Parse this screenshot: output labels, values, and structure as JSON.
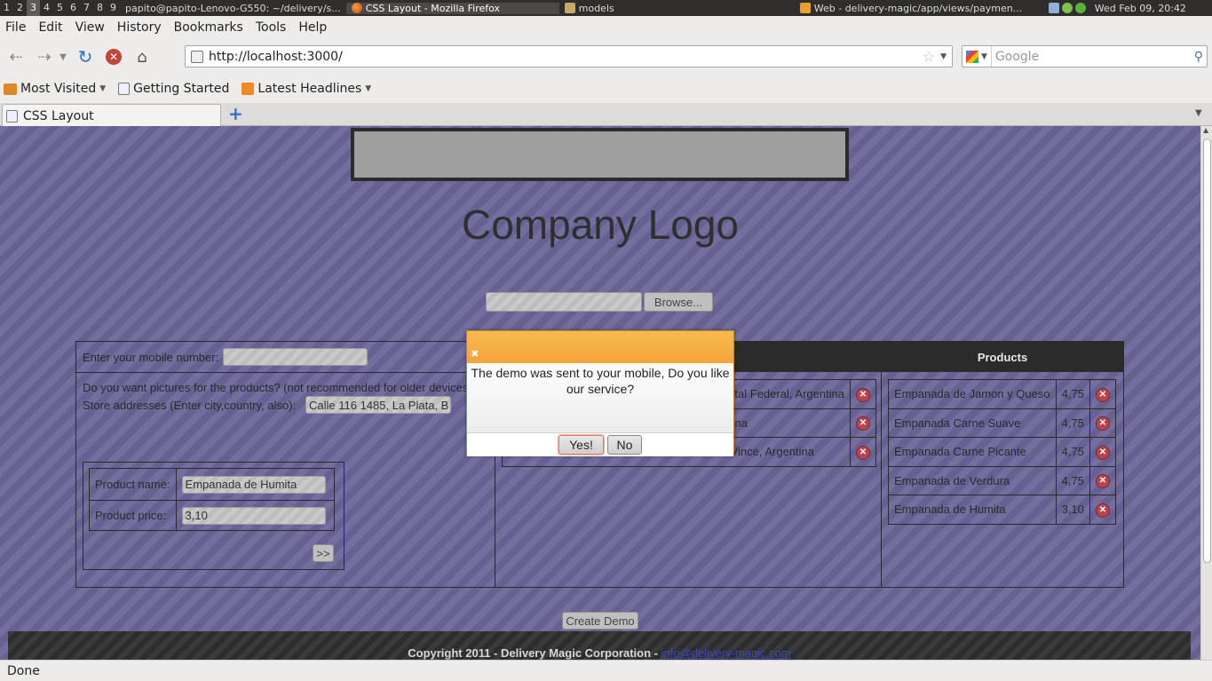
{
  "topbar": {
    "workspaces": [
      "1",
      "2",
      "3",
      "4",
      "5",
      "6",
      "7",
      "8",
      "9"
    ],
    "active_workspace": "3",
    "tasks": [
      {
        "label": "papito@papito-Lenovo-G550: ~/delivery/s..."
      },
      {
        "label": "CSS Layout - Mozilla Firefox"
      },
      {
        "label": "models"
      },
      {
        "label": "Web - delivery-magic/app/views/paymen..."
      }
    ],
    "clock": "Wed Feb 09, 20:42"
  },
  "menu": [
    "File",
    "Edit",
    "View",
    "History",
    "Bookmarks",
    "Tools",
    "Help"
  ],
  "nav": {
    "url": "http://localhost:3000/",
    "search_placeholder": "Google"
  },
  "bookmarks": [
    {
      "label": "Most Visited",
      "icon": "folder-icon",
      "dropdown": true
    },
    {
      "label": "Getting Started",
      "icon": "page-icon",
      "dropdown": false
    },
    {
      "label": "Latest Headlines",
      "icon": "rss-icon",
      "dropdown": true
    }
  ],
  "tab": {
    "title": "CSS Layout",
    "new_tab": "+"
  },
  "page": {
    "logo_text": "Company Logo",
    "browse_label": "Browse...",
    "mobile_label": "Enter your mobile number:",
    "pictures_question": "Do you want pictures for the products? (not recommended for older devices)",
    "store_label": "Store addresses (Enter city,country, also):",
    "store_value": "Calle 116 1485, La Plata, B",
    "product_name_label": "Product name:",
    "product_name_value": "Empanada de Humita",
    "product_price_label": "Product price:",
    "product_price_value": "3,10",
    "add_button": ">>",
    "products_header": "Products",
    "addresses": [
      {
        "text": "tal Federal, Argentina"
      },
      {
        "text": "rgentina"
      },
      {
        "text": "Vince, Argentina"
      }
    ],
    "products": [
      {
        "name": "Empanada de Jamon y Queso",
        "price": "4,75"
      },
      {
        "name": "Empanada Carne Suave",
        "price": "4,75"
      },
      {
        "name": "Empanada Carne Picante",
        "price": "4,75"
      },
      {
        "name": "Empanada de Verdura",
        "price": "4,75"
      },
      {
        "name": "Empanada de Humita",
        "price": "3,10"
      }
    ],
    "create_demo": "Create Demo",
    "footer_text": "Copyright 2011 - Delivery Magic Corporation - ",
    "footer_link": "info@delivery-magic.com"
  },
  "dialog": {
    "message": "The demo was sent to your mobile, Do you like our service?",
    "yes": "Yes!",
    "no": "No"
  },
  "status": "Done",
  "colors": {
    "page_bg": "#6a6598",
    "dialog_title": "#f2a43a",
    "header_bg": "#2b2b2b"
  }
}
